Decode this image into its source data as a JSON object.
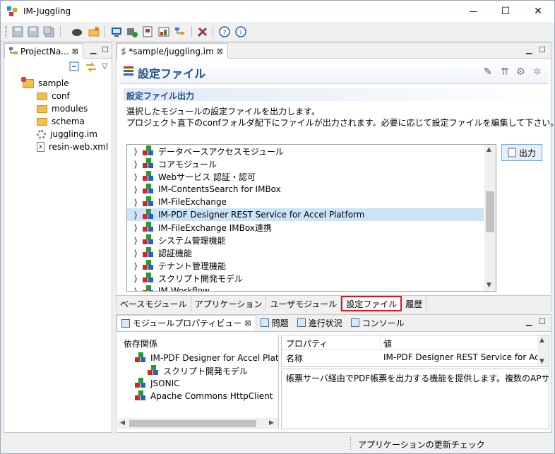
{
  "window": {
    "title": "IM-Juggling",
    "minimize_glyph": "—",
    "maximize_glyph": "☐",
    "close_glyph": "✕"
  },
  "toolbar": {
    "icons": [
      "save-icon",
      "save-as-icon",
      "save-all-icon",
      "deploy-icon",
      "open-folder-icon",
      "monitor-icon",
      "add-module-icon",
      "report-icon",
      "image-icon",
      "tree-icon",
      "tools-icon",
      "help-icon",
      "info-icon"
    ]
  },
  "project_view": {
    "tab_label": "ProjectNa...",
    "close_glyph": "⊠",
    "items": [
      {
        "label": "sample",
        "type": "project",
        "indent": 0
      },
      {
        "label": "conf",
        "type": "folder",
        "indent": 1
      },
      {
        "label": "modules",
        "type": "folder",
        "indent": 1
      },
      {
        "label": "schema",
        "type": "folder",
        "indent": 1
      },
      {
        "label": "juggling.im",
        "type": "gear",
        "indent": 1
      },
      {
        "label": "resin-web.xml",
        "type": "xml",
        "indent": 1
      }
    ]
  },
  "editor": {
    "tab_label": "*sample/juggling.im",
    "close_glyph": "⊠",
    "header_title": "設定ファイル",
    "section_title": "設定ファイル出力",
    "description_line1": "選択したモジュールの設定ファイルを出力します。",
    "description_line2": "プロジェクト直下のconfフォルダ配下にファイルが出力されます。必要に応じて設定ファイルを編集して下さい。",
    "output_button": "出力",
    "modules": [
      "データベースアクセスモジュール",
      "コアモジュール",
      "Webサービス 認証・認可",
      "IM-ContentsSearch for IMBox",
      "IM-FileExchange",
      "IM-PDF Designer REST Service for Accel Platform",
      "IM-FileExchange IMBox連携",
      "システム管理機能",
      "認証機能",
      "テナント管理機能",
      "スクリプト開発モデル",
      "IM-Workflow"
    ],
    "selected_module_index": 5,
    "bottom_tabs": [
      "ベースモジュール",
      "アプリケーション",
      "ユーザモジュール",
      "設定ファイル",
      "履歴"
    ],
    "selected_bottom_tab": 3
  },
  "properties_view": {
    "tabs": [
      {
        "label": "モジュールプロパティビュー",
        "icon": "module-prop-icon"
      },
      {
        "label": "問題",
        "icon": "problems-icon"
      },
      {
        "label": "進行状況",
        "icon": "progress-icon"
      },
      {
        "label": "コンソール",
        "icon": "console-icon"
      }
    ],
    "close_glyph": "⊠",
    "dependency_header": "依存関係",
    "dependencies": [
      {
        "label": "IM-PDF Designer for Accel Platform",
        "indent": 1
      },
      {
        "label": "スクリプト開発モデル",
        "indent": 2
      },
      {
        "label": "JSONIC",
        "indent": 1
      },
      {
        "label": "Apache Commons HttpClient",
        "indent": 1
      }
    ],
    "prop_header_name": "プロパティ",
    "prop_header_value": "値",
    "prop_rows": [
      {
        "name": "名称",
        "value": "IM-PDF Designer REST Service for Ac..."
      }
    ],
    "description": "帳票サーバ経由でPDF帳票を出力する機能を提供します。複数のAPサーバから"
  },
  "status_bar": {
    "text": "アプリケーションの更新チェック"
  }
}
